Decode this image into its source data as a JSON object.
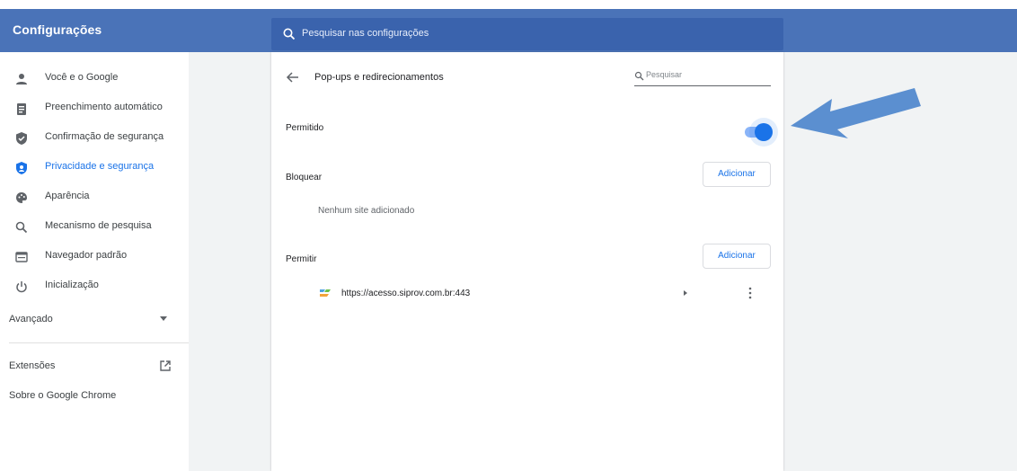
{
  "app": {
    "title": "Configurações"
  },
  "search": {
    "placeholder": "Pesquisar nas configurações",
    "icon": "search-icon"
  },
  "sidebar": {
    "items": [
      {
        "label": "Você e o Google",
        "icon": "person-icon",
        "active": false
      },
      {
        "label": "Preenchimento automático",
        "icon": "clipboard-icon",
        "active": false
      },
      {
        "label": "Confirmação de segurança",
        "icon": "shield-check-icon",
        "active": false
      },
      {
        "label": "Privacidade e segurança",
        "icon": "shield-privacy-icon",
        "active": true
      },
      {
        "label": "Aparência",
        "icon": "palette-icon",
        "active": false
      },
      {
        "label": "Mecanismo de pesquisa",
        "icon": "search-icon",
        "active": false
      },
      {
        "label": "Navegador padrão",
        "icon": "browser-window-icon",
        "active": false
      },
      {
        "label": "Inicialização",
        "icon": "power-icon",
        "active": false
      }
    ],
    "advanced": "Avançado",
    "extensions": "Extensões",
    "about": "Sobre o Google Chrome"
  },
  "page": {
    "title": "Pop-ups e redirecionamentos",
    "search_placeholder": "Pesquisar",
    "allowed_label": "Permitido",
    "allowed_on": true,
    "block_label": "Bloquear",
    "block_button": "Adicionar",
    "block_empty": "Nenhum site adicionado",
    "allow_label": "Permitir",
    "allow_button": "Adicionar",
    "allow_sites": [
      "https://acesso.siprov.com.br:443"
    ]
  },
  "colors": {
    "header": "#4a73b8",
    "accent": "#1a73e8",
    "annotation_arrow": "#5b8fd0"
  }
}
